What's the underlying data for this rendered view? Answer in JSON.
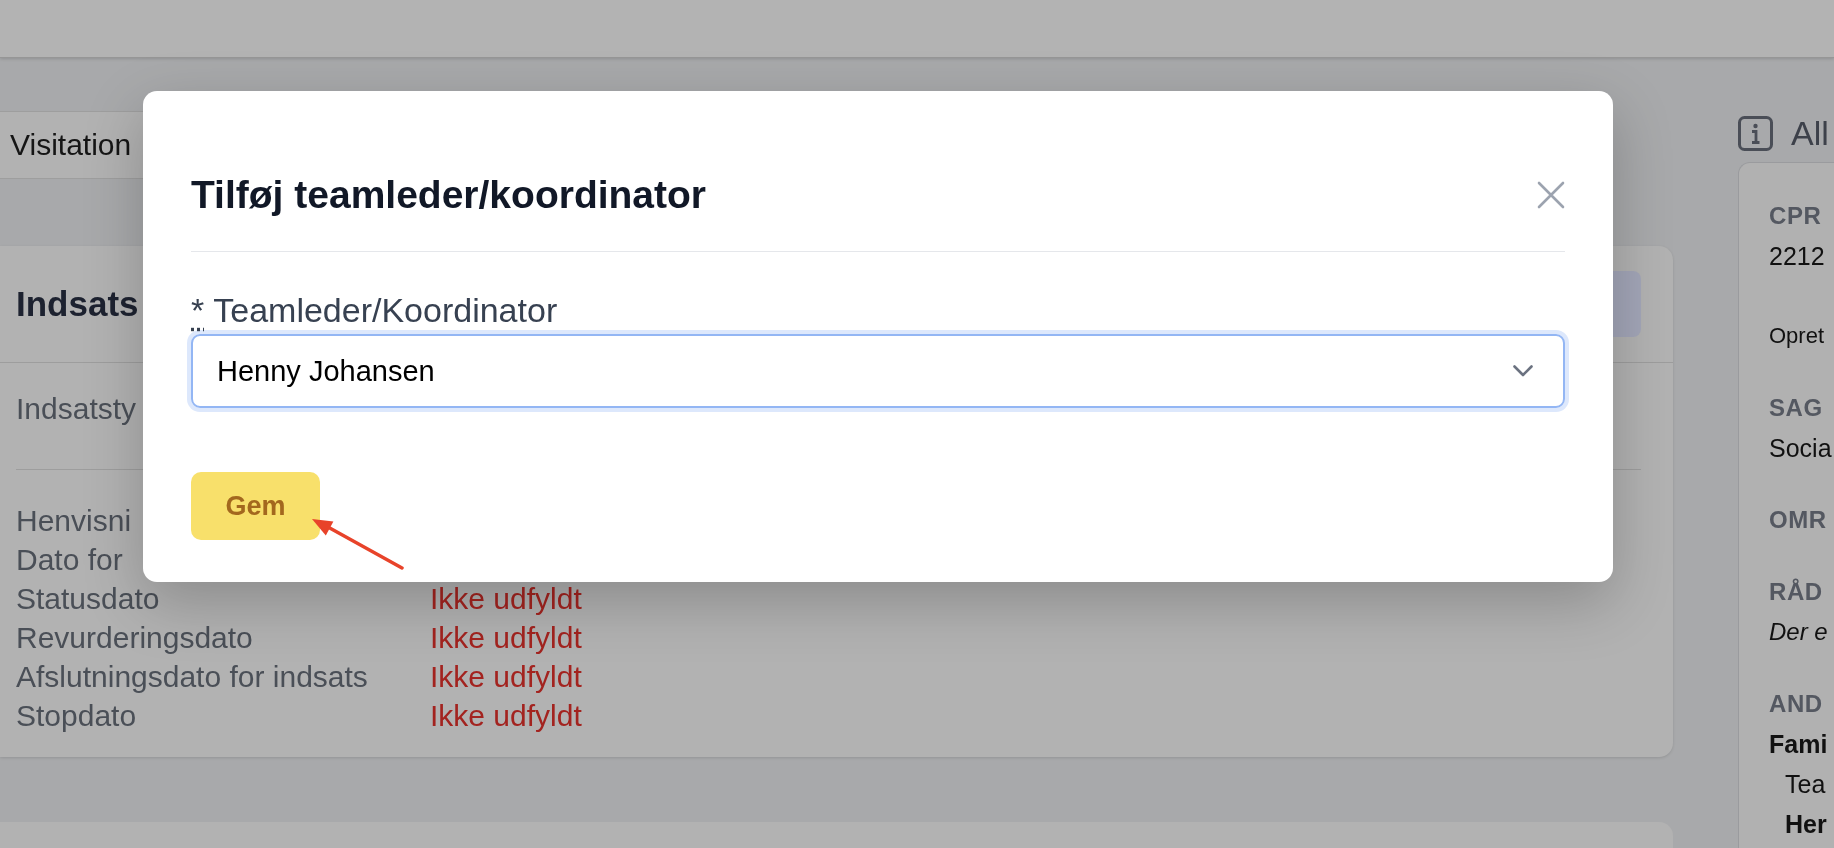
{
  "tabs": [
    {
      "label": "Visitation"
    }
  ],
  "section": {
    "title": "Indsats",
    "type_label": "Indsatsty",
    "fields": [
      {
        "label": "Henvisni"
      },
      {
        "label": "Dato for"
      },
      {
        "label": "Statusdato",
        "value": "Ikke udfyldt",
        "missing": true
      },
      {
        "label": "Revurderingsdato",
        "value": "Ikke udfyldt",
        "missing": true
      },
      {
        "label": "Afslutningsdato for indsats",
        "value": "Ikke udfyldt",
        "missing": true
      },
      {
        "label": "Stopdato",
        "value": "Ikke udfyldt",
        "missing": true
      }
    ]
  },
  "dialog": {
    "title": "Tilføj teamleder/koordinator",
    "field": {
      "required_mark": "*",
      "label": "Teamleder/Koordinator",
      "value": "Henny Johansen",
      "focused": true
    },
    "buttons": [
      {
        "label": "Gem",
        "kind": "primary"
      }
    ]
  },
  "info_panel": {
    "title": "All",
    "sections": [
      {
        "heading": "CPR",
        "lines": [
          {
            "kind": "value",
            "text": "2212"
          },
          {
            "kind": "note",
            "text": "Opret"
          }
        ]
      },
      {
        "heading": "SAG",
        "lines": [
          {
            "kind": "value",
            "text": "Socia"
          }
        ]
      },
      {
        "heading": "OMR"
      },
      {
        "heading": "RÅD",
        "lines": [
          {
            "kind": "empty",
            "text": "Der e"
          }
        ]
      },
      {
        "heading": "AND",
        "lines": [
          {
            "kind": "group",
            "text": "Fami"
          },
          {
            "kind": "role",
            "text": "Tea"
          },
          {
            "kind": "person",
            "text": "Her"
          }
        ]
      }
    ]
  }
}
